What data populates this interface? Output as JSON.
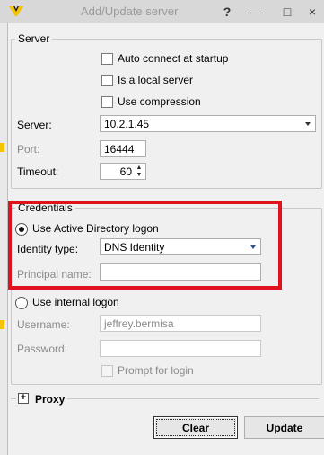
{
  "window": {
    "title": "Add/Update server",
    "help_label": "?",
    "minimize_label": "—",
    "maximize_label": "□",
    "close_label": "×"
  },
  "server": {
    "group_title": "Server",
    "auto_connect_label": "Auto connect at startup",
    "auto_connect_checked": false,
    "local_server_label": "Is a local server",
    "local_server_checked": false,
    "compression_label": "Use compression",
    "compression_checked": false,
    "server_label": "Server:",
    "server_value": "10.2.1.45",
    "port_label": "Port:",
    "port_value": "16444",
    "timeout_label": "Timeout:",
    "timeout_value": "60"
  },
  "credentials": {
    "group_title": "Credentials",
    "ad_logon_label": "Use Active Directory logon",
    "ad_logon_selected": true,
    "identity_type_label": "Identity type:",
    "identity_type_value": "DNS Identity",
    "principal_name_label": "Principal name:",
    "principal_name_value": "",
    "internal_logon_label": "Use internal logon",
    "internal_logon_selected": false,
    "username_label": "Username:",
    "username_value": "jeffrey.bermisa",
    "password_label": "Password:",
    "password_value": "",
    "prompt_login_label": "Prompt for login",
    "prompt_login_checked": false
  },
  "proxy": {
    "expander_label": "+",
    "label": "Proxy"
  },
  "buttons": {
    "clear_label": "Clear",
    "update_label": "Update"
  },
  "colors": {
    "highlight": "#e0121d",
    "logo": "#f5c400"
  }
}
